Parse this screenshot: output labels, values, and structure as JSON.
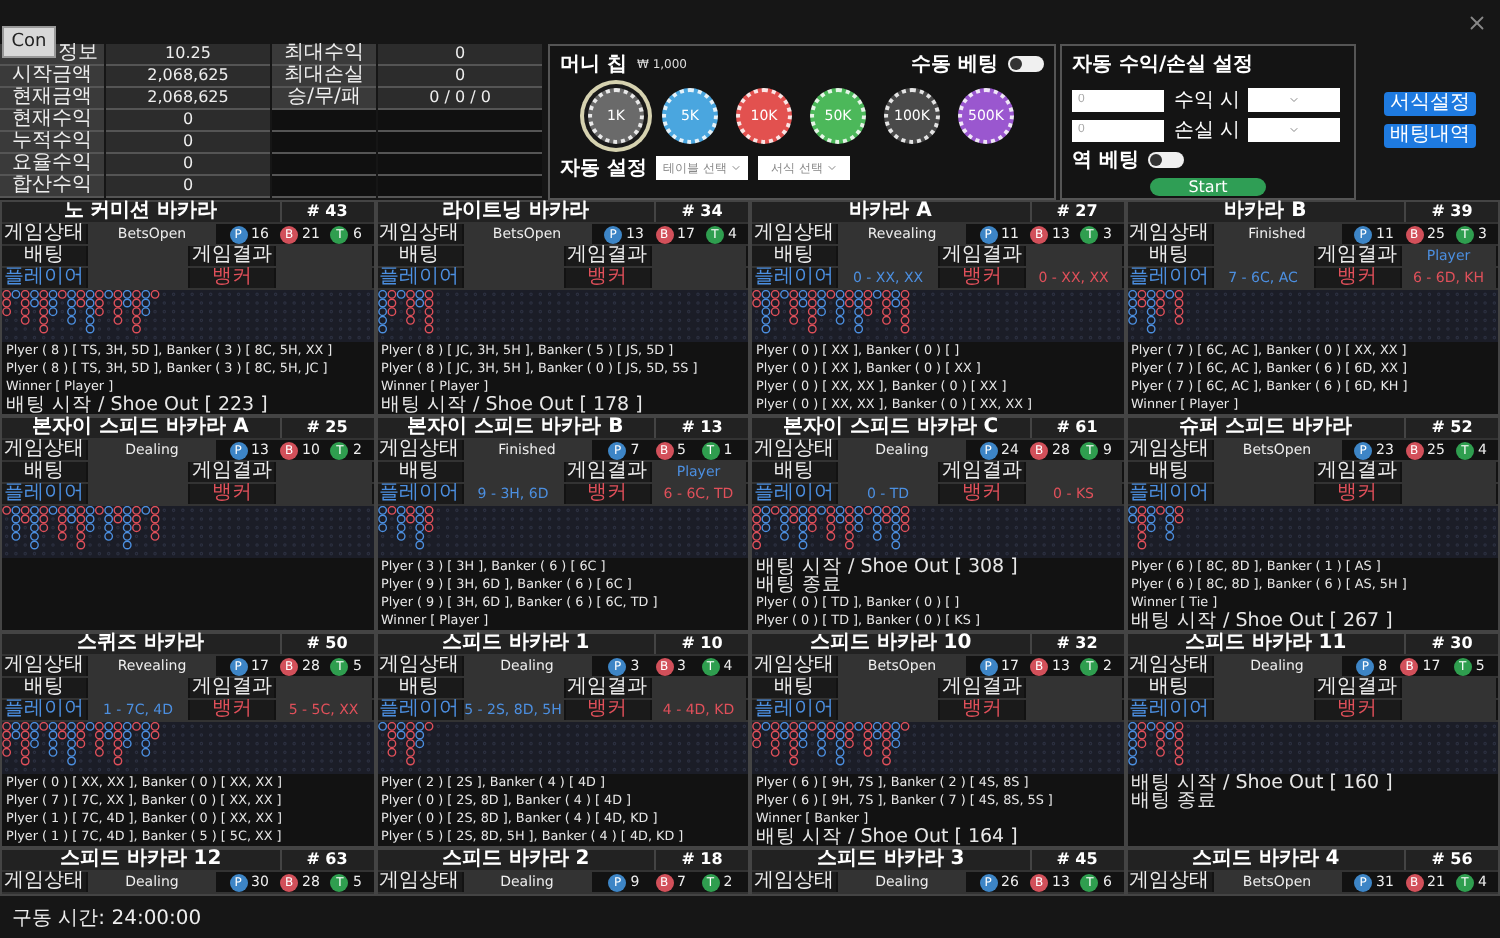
{
  "connect_button": "Con",
  "game_info": {
    "left": [
      {
        "label": "정보",
        "value": "10.25"
      },
      {
        "label": "시작금액",
        "value": "2,068,625"
      },
      {
        "label": "현재금액",
        "value": "2,068,625"
      },
      {
        "label": "현재수익",
        "value": "0"
      },
      {
        "label": "누적수익",
        "value": "0"
      },
      {
        "label": "요율수익",
        "value": "0"
      },
      {
        "label": "합산수익",
        "value": "0"
      }
    ],
    "right": [
      {
        "label": "최대수익",
        "value": "0"
      },
      {
        "label": "최대손실",
        "value": "0"
      },
      {
        "label": "승/무/패",
        "value": "0 / 0 / 0"
      }
    ]
  },
  "money_chip": {
    "title": "머니 칩",
    "unit": "₩ 1,000",
    "manual_bet": {
      "label": "수동 베팅",
      "on": false
    },
    "chips": [
      {
        "label": "1K",
        "color": "#6a6a6a",
        "selected": true
      },
      {
        "label": "5K",
        "color": "#4aa6df",
        "selected": false
      },
      {
        "label": "10K",
        "color": "#e2514f",
        "selected": false
      },
      {
        "label": "50K",
        "color": "#4cb85a",
        "selected": false
      },
      {
        "label": "100K",
        "color": "#4a4a4a",
        "selected": false
      },
      {
        "label": "500K",
        "color": "#9a57cf",
        "selected": false
      }
    ],
    "auto_setting": {
      "label": "자동 설정",
      "selects": [
        "테이블 선택",
        "서식 선택"
      ]
    }
  },
  "auto_profit": {
    "title": "자동 수익/손실 설정",
    "rows": [
      {
        "placeholder": "0",
        "label": "수익 시"
      },
      {
        "placeholder": "0",
        "label": "손실 시"
      }
    ],
    "reverse_bet": {
      "label": "역 베팅",
      "on": false
    },
    "start": "Start"
  },
  "side_buttons": [
    "서식설정",
    "배팅내역"
  ],
  "tables": [
    {
      "name": "노 커미션 바카라",
      "number": "# 43",
      "status": "BetsOpen",
      "labels": [
        "게임상태",
        "배팅",
        "게임결과",
        "플레이어",
        "뱅커"
      ],
      "counts": [
        {
          "mark": "P",
          "value": "16",
          "color": "#3d85c6"
        },
        {
          "mark": "B",
          "value": "21",
          "color": "#d2505a"
        },
        {
          "mark": "T",
          "value": "6",
          "color": "#2f9e4f"
        }
      ],
      "log": [
        {
          "kind": "hand",
          "text": "Plyer ( 8 ) [ TS, 3H, 5D ], Banker ( 3 ) [ 8C, 5H, XX ]"
        },
        {
          "kind": "hand",
          "text": "Plyer ( 8 ) [ TS, 3H, 5D ], Banker ( 3 ) [ 8C, 5H, JC ]"
        },
        {
          "kind": "hand",
          "text": "Winner [ Player ]"
        },
        {
          "kind": "event",
          "text": "배팅 시작 / Shoe Out [ 223 ]"
        }
      ]
    },
    {
      "name": "라이트닝 바카라",
      "number": "# 34",
      "status": "BetsOpen",
      "labels": [
        "게임상태",
        "배팅",
        "게임결과",
        "플레이어",
        "뱅커"
      ],
      "counts": [
        {
          "mark": "P",
          "value": "13",
          "color": "#3d85c6"
        },
        {
          "mark": "B",
          "value": "17",
          "color": "#d2505a"
        },
        {
          "mark": "T",
          "value": "4",
          "color": "#2f9e4f"
        }
      ],
      "log": [
        {
          "kind": "hand",
          "text": "Plyer ( 8 ) [ JC, 3H, 5H ], Banker ( 5 ) [ JS, 5D ]"
        },
        {
          "kind": "hand",
          "text": "Plyer ( 8 ) [ JC, 3H, 5H ], Banker ( 0 ) [ JS, 5D, 5S ]"
        },
        {
          "kind": "hand",
          "text": "Winner [ Player ]"
        },
        {
          "kind": "event",
          "text": "배팅 시작 / Shoe Out [ 178 ]"
        }
      ]
    },
    {
      "name": "바카라 A",
      "number": "# 27",
      "status": "Revealing",
      "labels": [
        "게임상태",
        "배팅",
        "게임결과",
        "플레이어",
        "뱅커"
      ],
      "counts": [
        {
          "mark": "P",
          "value": "11",
          "color": "#3d85c6"
        },
        {
          "mark": "B",
          "value": "13",
          "color": "#d2505a"
        },
        {
          "mark": "T",
          "value": "3",
          "color": "#2f9e4f"
        }
      ],
      "player": "0 - XX, XX",
      "banker": "0 - XX, XX",
      "log": [
        {
          "kind": "hand",
          "text": "Plyer ( 0 ) [ XX ], Banker ( 0 ) [  ]"
        },
        {
          "kind": "hand",
          "text": "Plyer ( 0 ) [ XX ], Banker ( 0 ) [ XX ]"
        },
        {
          "kind": "hand",
          "text": "Plyer ( 0 ) [ XX, XX ], Banker ( 0 ) [ XX ]"
        },
        {
          "kind": "hand",
          "text": "Plyer ( 0 ) [ XX, XX ], Banker ( 0 ) [ XX, XX ]"
        }
      ]
    },
    {
      "name": "바카라 B",
      "number": "# 39",
      "status": "Finished",
      "labels": [
        "게임상태",
        "배팅",
        "게임결과",
        "플레이어",
        "뱅커"
      ],
      "counts": [
        {
          "mark": "P",
          "value": "11",
          "color": "#3d85c6"
        },
        {
          "mark": "B",
          "value": "25",
          "color": "#d2505a"
        },
        {
          "mark": "T",
          "value": "3",
          "color": "#2f9e4f"
        }
      ],
      "result": "Player",
      "player": "7 - 6C, AC",
      "banker": "6 - 6D, KH",
      "log": [
        {
          "kind": "hand",
          "text": "Plyer ( 7 ) [ 6C, AC ], Banker ( 0 ) [ XX, XX ]"
        },
        {
          "kind": "hand",
          "text": "Plyer ( 7 ) [ 6C, AC ], Banker ( 6 ) [ 6D, XX ]"
        },
        {
          "kind": "hand",
          "text": "Plyer ( 7 ) [ 6C, AC ], Banker ( 6 ) [ 6D, KH ]"
        },
        {
          "kind": "hand",
          "text": "Winner [ Player ]"
        }
      ]
    },
    {
      "name": "본자이 스피드 바카라 A",
      "number": "# 25",
      "status": "Dealing",
      "labels": [
        "게임상태",
        "배팅",
        "게임결과",
        "플레이어",
        "뱅커"
      ],
      "counts": [
        {
          "mark": "P",
          "value": "13",
          "color": "#3d85c6"
        },
        {
          "mark": "B",
          "value": "10",
          "color": "#d2505a"
        },
        {
          "mark": "T",
          "value": "2",
          "color": "#2f9e4f"
        }
      ]
    },
    {
      "name": "본자이 스피드 바카라 B",
      "number": "# 13",
      "status": "Finished",
      "labels": [
        "게임상태",
        "배팅",
        "게임결과",
        "플레이어",
        "뱅커"
      ],
      "counts": [
        {
          "mark": "P",
          "value": "7",
          "color": "#3d85c6"
        },
        {
          "mark": "B",
          "value": "5",
          "color": "#d2505a"
        },
        {
          "mark": "T",
          "value": "1",
          "color": "#2f9e4f"
        }
      ],
      "result": "Player",
      "player": "9 - 3H, 6D",
      "banker": "6 - 6C, TD",
      "log": [
        {
          "kind": "hand",
          "text": "Plyer ( 3 ) [ 3H ], Banker ( 6 ) [ 6C ]"
        },
        {
          "kind": "hand",
          "text": "Plyer ( 9 ) [ 3H, 6D ], Banker ( 6 ) [ 6C ]"
        },
        {
          "kind": "hand",
          "text": "Plyer ( 9 ) [ 3H, 6D ], Banker ( 6 ) [ 6C, TD ]"
        },
        {
          "kind": "hand",
          "text": "Winner [ Player ]"
        }
      ]
    },
    {
      "name": "본자이 스피드 바카라 C",
      "number": "# 61",
      "status": "Dealing",
      "labels": [
        "게임상태",
        "배팅",
        "게임결과",
        "플레이어",
        "뱅커"
      ],
      "counts": [
        {
          "mark": "P",
          "value": "24",
          "color": "#3d85c6"
        },
        {
          "mark": "B",
          "value": "28",
          "color": "#d2505a"
        },
        {
          "mark": "T",
          "value": "9",
          "color": "#2f9e4f"
        }
      ],
      "player": "0 - TD",
      "banker": "0 - KS",
      "log": [
        {
          "kind": "event",
          "text": "배팅 시작 / Shoe Out [ 308 ]"
        },
        {
          "kind": "event",
          "text": "배팅 종료"
        },
        {
          "kind": "hand",
          "text": "Plyer ( 0 ) [ TD ], Banker ( 0 ) [  ]"
        },
        {
          "kind": "hand",
          "text": "Plyer ( 0 ) [ TD ], Banker ( 0 ) [ KS ]"
        }
      ]
    },
    {
      "name": "슈퍼 스피드 바카라",
      "number": "# 52",
      "status": "BetsOpen",
      "labels": [
        "게임상태",
        "배팅",
        "게임결과",
        "플레이어",
        "뱅커"
      ],
      "counts": [
        {
          "mark": "P",
          "value": "23",
          "color": "#3d85c6"
        },
        {
          "mark": "B",
          "value": "25",
          "color": "#d2505a"
        },
        {
          "mark": "T",
          "value": "4",
          "color": "#2f9e4f"
        }
      ],
      "log": [
        {
          "kind": "hand",
          "text": "Plyer ( 6 ) [ 8C, 8D ], Banker ( 1 ) [ AS ]"
        },
        {
          "kind": "hand",
          "text": "Plyer ( 6 ) [ 8C, 8D ], Banker ( 6 ) [ AS, 5H ]"
        },
        {
          "kind": "hand",
          "text": "Winner [ Tie ]"
        },
        {
          "kind": "event",
          "text": "배팅 시작 / Shoe Out [ 267 ]"
        }
      ]
    },
    {
      "name": "스퀴즈 바카라",
      "number": "# 50",
      "status": "Revealing",
      "labels": [
        "게임상태",
        "배팅",
        "게임결과",
        "플레이어",
        "뱅커"
      ],
      "counts": [
        {
          "mark": "P",
          "value": "17",
          "color": "#3d85c6"
        },
        {
          "mark": "B",
          "value": "28",
          "color": "#d2505a"
        },
        {
          "mark": "T",
          "value": "5",
          "color": "#2f9e4f"
        }
      ],
      "player": "1 - 7C, 4D",
      "banker": "5 - 5C, XX",
      "log": [
        {
          "kind": "hand",
          "text": "Plyer ( 0 ) [ XX, XX ], Banker ( 0 ) [ XX, XX ]"
        },
        {
          "kind": "hand",
          "text": "Plyer ( 7 ) [ 7C, XX ], Banker ( 0 ) [ XX, XX ]"
        },
        {
          "kind": "hand",
          "text": "Plyer ( 1 ) [ 7C, 4D ], Banker ( 0 ) [ XX, XX ]"
        },
        {
          "kind": "hand",
          "text": "Plyer ( 1 ) [ 7C, 4D ], Banker ( 5 ) [ 5C, XX ]"
        }
      ]
    },
    {
      "name": "스피드 바카라 1",
      "number": "# 10",
      "status": "Dealing",
      "labels": [
        "게임상태",
        "배팅",
        "게임결과",
        "플레이어",
        "뱅커"
      ],
      "counts": [
        {
          "mark": "P",
          "value": "3",
          "color": "#3d85c6"
        },
        {
          "mark": "B",
          "value": "3",
          "color": "#d2505a"
        },
        {
          "mark": "T",
          "value": "4",
          "color": "#2f9e4f"
        }
      ],
      "player": "5 - 2S, 8D, 5H",
      "banker": "4 - 4D, KD",
      "log": [
        {
          "kind": "hand",
          "text": "Plyer ( 2 ) [ 2S ], Banker ( 4 ) [ 4D ]"
        },
        {
          "kind": "hand",
          "text": "Plyer ( 0 ) [ 2S, 8D ], Banker ( 4 ) [ 4D ]"
        },
        {
          "kind": "hand",
          "text": "Plyer ( 0 ) [ 2S, 8D ], Banker ( 4 ) [ 4D, KD ]"
        },
        {
          "kind": "hand",
          "text": "Plyer ( 5 ) [ 2S, 8D, 5H ], Banker ( 4 ) [ 4D, KD ]"
        }
      ]
    },
    {
      "name": "스피드 바카라 10",
      "number": "# 32",
      "status": "BetsOpen",
      "labels": [
        "게임상태",
        "배팅",
        "게임결과",
        "플레이어",
        "뱅커"
      ],
      "counts": [
        {
          "mark": "P",
          "value": "17",
          "color": "#3d85c6"
        },
        {
          "mark": "B",
          "value": "13",
          "color": "#d2505a"
        },
        {
          "mark": "T",
          "value": "2",
          "color": "#2f9e4f"
        }
      ],
      "log": [
        {
          "kind": "hand",
          "text": "Plyer ( 6 ) [ 9H, 7S ], Banker ( 2 ) [ 4S, 8S ]"
        },
        {
          "kind": "hand",
          "text": "Plyer ( 6 ) [ 9H, 7S ], Banker ( 7 ) [ 4S, 8S, 5S ]"
        },
        {
          "kind": "hand",
          "text": "Winner [ Banker ]"
        },
        {
          "kind": "event",
          "text": "배팅 시작 / Shoe Out [ 164 ]"
        }
      ]
    },
    {
      "name": "스피드 바카라 11",
      "number": "# 30",
      "status": "Dealing",
      "labels": [
        "게임상태",
        "배팅",
        "게임결과",
        "플레이어",
        "뱅커"
      ],
      "counts": [
        {
          "mark": "P",
          "value": "8",
          "color": "#3d85c6"
        },
        {
          "mark": "B",
          "value": "17",
          "color": "#d2505a"
        },
        {
          "mark": "T",
          "value": "5",
          "color": "#2f9e4f"
        }
      ],
      "log": [
        {
          "kind": "event",
          "text": "배팅 시작 / Shoe Out [ 160 ]"
        },
        {
          "kind": "event",
          "text": "배팅 종료"
        }
      ]
    },
    {
      "name": "스피드 바카라 12",
      "number": "# 63",
      "status": "Dealing",
      "labels": [
        "게임상태"
      ],
      "counts": [
        {
          "mark": "P",
          "value": "30",
          "color": "#3d85c6"
        },
        {
          "mark": "B",
          "value": "28",
          "color": "#d2505a"
        },
        {
          "mark": "T",
          "value": "5",
          "color": "#2f9e4f"
        }
      ]
    },
    {
      "name": "스피드 바카라 2",
      "number": "# 18",
      "status": "Dealing",
      "labels": [
        "게임상태"
      ],
      "counts": [
        {
          "mark": "P",
          "value": "9",
          "color": "#3d85c6"
        },
        {
          "mark": "B",
          "value": "7",
          "color": "#d2505a"
        },
        {
          "mark": "T",
          "value": "2",
          "color": "#2f9e4f"
        }
      ]
    },
    {
      "name": "스피드 바카라 3",
      "number": "# 45",
      "status": "Dealing",
      "labels": [
        "게임상태"
      ],
      "counts": [
        {
          "mark": "P",
          "value": "26",
          "color": "#3d85c6"
        },
        {
          "mark": "B",
          "value": "13",
          "color": "#d2505a"
        },
        {
          "mark": "T",
          "value": "6",
          "color": "#2f9e4f"
        }
      ]
    },
    {
      "name": "스피드 바카라 4",
      "number": "# 56",
      "status": "BetsOpen",
      "labels": [
        "게임상태"
      ],
      "counts": [
        {
          "mark": "P",
          "value": "31",
          "color": "#3d85c6"
        },
        {
          "mark": "B",
          "value": "21",
          "color": "#d2505a"
        },
        {
          "mark": "T",
          "value": "4",
          "color": "#2f9e4f"
        }
      ]
    }
  ],
  "status_bar": {
    "label": "구동 시간: 24:00:00"
  }
}
